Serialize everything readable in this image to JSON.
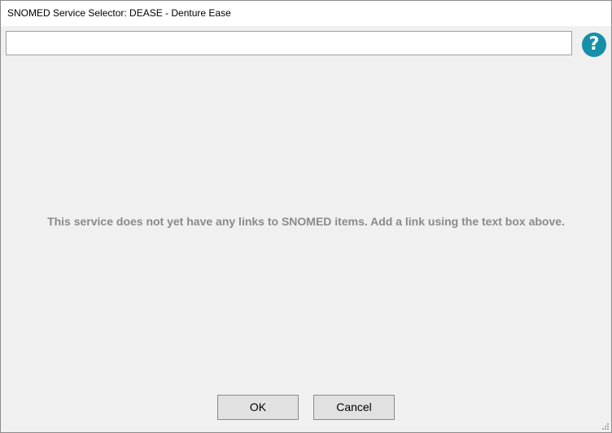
{
  "window": {
    "title": "SNOMED Service Selector: DEASE - Denture Ease"
  },
  "search": {
    "value": "",
    "placeholder": ""
  },
  "help": {
    "glyph": "?",
    "icon": "question-mark-icon",
    "color": "#1590a8"
  },
  "main": {
    "empty_message": "This service does not yet have any links to SNOMED items. Add a link using the text box above."
  },
  "buttons": {
    "ok_label": "OK",
    "cancel_label": "Cancel"
  }
}
